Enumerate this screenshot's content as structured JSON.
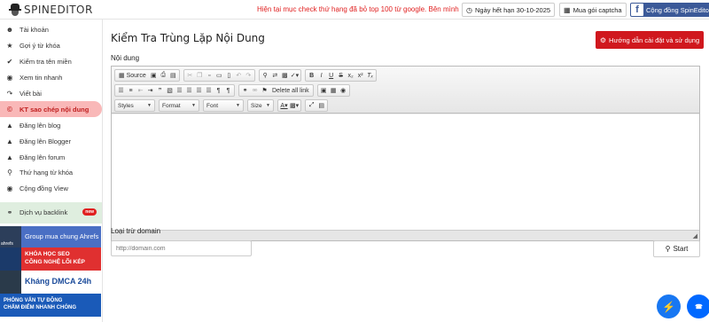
{
  "header": {
    "logo_text": "SPINEDITOR",
    "announcement": "Hiện tại mục check thứ hạng đã bỏ top 100 từ google. Bên mình",
    "expiry": "Ngày hết hạn 30-10-2025",
    "captcha": "Mua gói captcha",
    "community_fb": "Cộng đồng SpinEditor",
    "fb_letter": "f"
  },
  "sidebar": {
    "items": [
      {
        "label": "Tài khoản",
        "icon": "user-icon"
      },
      {
        "label": "Gợi ý từ khóa",
        "icon": "star-icon"
      },
      {
        "label": "Kiểm tra tên miền",
        "icon": "check-icon"
      },
      {
        "label": "Xem tin nhanh",
        "icon": "eye-icon"
      },
      {
        "label": "Viết bài",
        "icon": "share-icon"
      },
      {
        "label": "KT sao chép nội dung",
        "icon": "copyright-icon"
      },
      {
        "label": "Đăng lên blog",
        "icon": "upload-icon"
      },
      {
        "label": "Đăng lên Blogger",
        "icon": "upload-icon"
      },
      {
        "label": "Đăng lên forum",
        "icon": "upload-icon"
      },
      {
        "label": "Thứ hạng từ khóa",
        "icon": "search-icon"
      },
      {
        "label": "Cộng đồng View",
        "icon": "eye-icon"
      }
    ],
    "backlink": {
      "label": "Dịch vụ backlink",
      "badge": "new"
    },
    "banners": {
      "ahrefs": "Group mua chung Ahrefs",
      "ahrefs_logo": "ahrefs",
      "seo_line1": "KHÓA HỌC SEO",
      "seo_line2": "CÔNG NGHỆ LÕI KÉP",
      "dmca": "Kháng DMCA 24h",
      "interview_line1": "PHỎNG VẤN TỰ ĐỘNG",
      "interview_line2": "CHẤM ĐIỂM NHANH CHÓNG"
    }
  },
  "main": {
    "title": "Kiểm Tra Trùng Lặp Nội Dung",
    "guide_button": "Hướng dẫn cài đặt và sử dụng",
    "content_label": "Nội dung",
    "exclude_label": "Loại trừ domain",
    "domain_placeholder": "http://domain.com",
    "start_button": "Start"
  },
  "editor": {
    "source_label": "Source",
    "delete_all_link": "Delete all link",
    "styles": "Styles",
    "format": "Format",
    "font": "Font",
    "size": "Size"
  },
  "colors": {
    "accent_red": "#d0181e",
    "active_bg": "#f9b8b8",
    "facebook": "#3b5998"
  }
}
